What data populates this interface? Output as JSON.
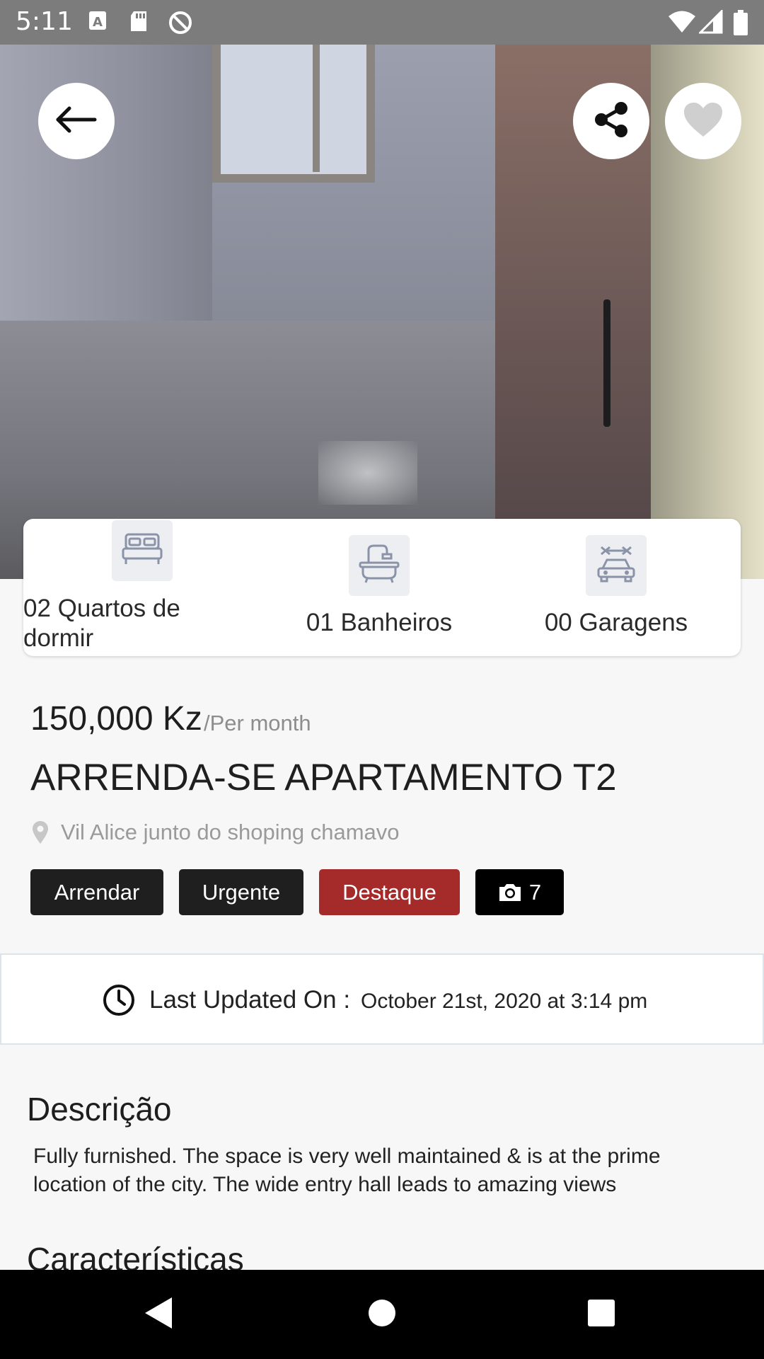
{
  "status_bar": {
    "time": "5:11",
    "icons": [
      "a-icon",
      "sd-card-icon",
      "circle-slash-icon",
      "wifi-icon",
      "signal-icon",
      "battery-icon"
    ]
  },
  "header": {
    "back_icon": "arrow-left-icon",
    "share_icon": "share-icon",
    "favorite_icon": "heart-icon"
  },
  "features": [
    {
      "icon": "bed-icon",
      "label": "02 Quartos de dormir"
    },
    {
      "icon": "bathtub-icon",
      "label": "01 Banheiros"
    },
    {
      "icon": "garage-car-icon",
      "label": "00 Garagens"
    }
  ],
  "listing": {
    "price": "150,000 Kz",
    "price_unit": "/Per month",
    "title": "ARRENDA-SE APARTAMENTO T2",
    "location": "Vil Alice junto do shoping chamavo"
  },
  "tags": [
    {
      "label": "Arrendar",
      "color": "#1f1f1f"
    },
    {
      "label": "Urgente",
      "color": "#1f1f1f"
    },
    {
      "label": "Destaque",
      "color": "#a52a2a"
    },
    {
      "label": "7",
      "icon": "camera-icon",
      "color": "#000000"
    }
  ],
  "updated": {
    "label": "Last Updated On :",
    "value": "October 21st, 2020 at 3:14 pm"
  },
  "description": {
    "title": "Descrição",
    "text_line1": "Fully furnished. The space is very well maintained & is at the prime",
    "text_line2": "location of the city. The wide entry hall leads to amazing views"
  },
  "characteristics": {
    "title": "Características"
  },
  "nav_bar": {
    "buttons": [
      "back-triangle-icon",
      "home-circle-icon",
      "recents-square-icon"
    ]
  }
}
